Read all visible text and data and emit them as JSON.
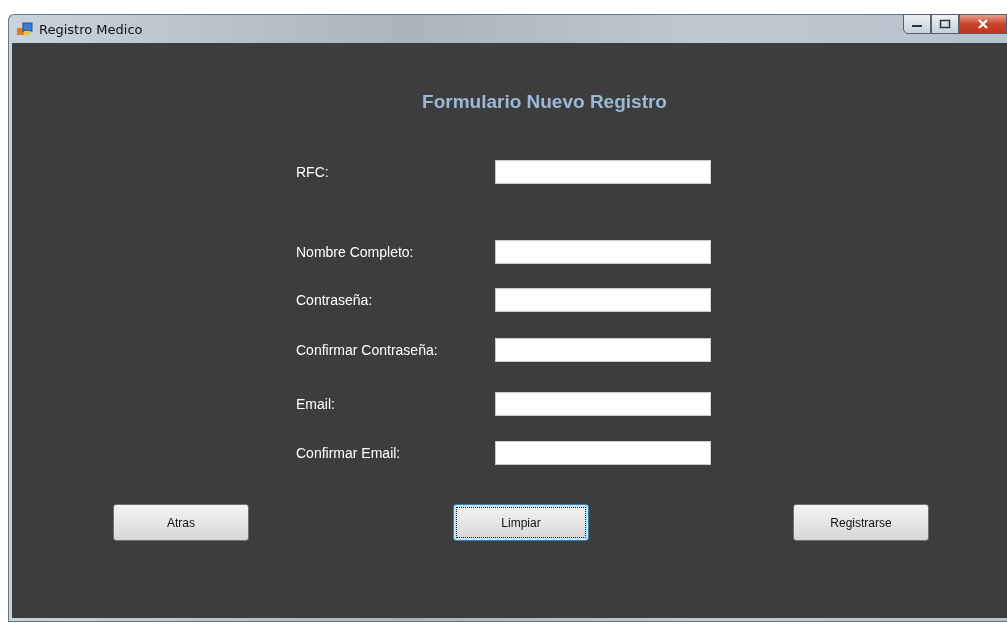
{
  "window": {
    "title": "Registro Medico"
  },
  "heading": "Formulario Nuevo Registro",
  "fields": [
    {
      "label": "RFC:"
    },
    {
      "label": "Nombre Completo:"
    },
    {
      "label": "Contraseña:"
    },
    {
      "label": "Confirmar Contraseña:"
    },
    {
      "label": "Email:"
    },
    {
      "label": "Confirmar Email:"
    }
  ],
  "buttons": [
    {
      "label": "Atras",
      "focused": false
    },
    {
      "label": "Limpiar",
      "focused": true
    },
    {
      "label": "Registrarse",
      "focused": false
    }
  ]
}
